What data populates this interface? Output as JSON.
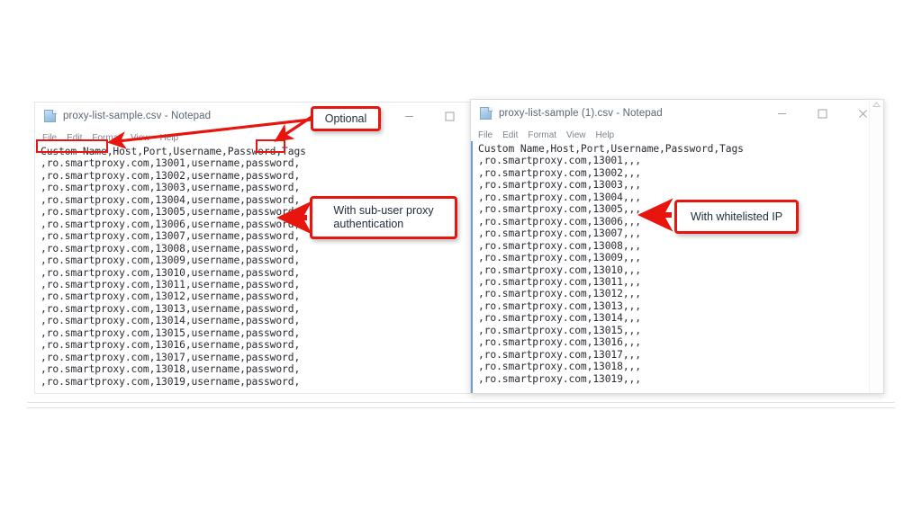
{
  "windows": {
    "left": {
      "title": "proxy-list-sample.csv - Notepad",
      "icon": "notepad-document-icon",
      "menu": [
        "File",
        "Edit",
        "Format",
        "View",
        "Help"
      ],
      "controls": [
        {
          "name": "minimize-button",
          "glyph": "minimize"
        },
        {
          "name": "maximize-button",
          "glyph": "maximize"
        }
      ],
      "text_lines": [
        "Custom Name,Host,Port,Username,Password,Tags",
        ",ro.smartproxy.com,13001,username,password,",
        ",ro.smartproxy.com,13002,username,password,",
        ",ro.smartproxy.com,13003,username,password,",
        ",ro.smartproxy.com,13004,username,password,",
        ",ro.smartproxy.com,13005,username,password,",
        ",ro.smartproxy.com,13006,username,password,",
        ",ro.smartproxy.com,13007,username,password,",
        ",ro.smartproxy.com,13008,username,password,",
        ",ro.smartproxy.com,13009,username,password,",
        ",ro.smartproxy.com,13010,username,password,",
        ",ro.smartproxy.com,13011,username,password,",
        ",ro.smartproxy.com,13012,username,password,",
        ",ro.smartproxy.com,13013,username,password,",
        ",ro.smartproxy.com,13014,username,password,",
        ",ro.smartproxy.com,13015,username,password,",
        ",ro.smartproxy.com,13016,username,password,",
        ",ro.smartproxy.com,13017,username,password,",
        ",ro.smartproxy.com,13018,username,password,",
        ",ro.smartproxy.com,13019,username,password,"
      ]
    },
    "right": {
      "title": "proxy-list-sample (1).csv - Notepad",
      "icon": "notepad-document-icon",
      "menu": [
        "File",
        "Edit",
        "Format",
        "View",
        "Help"
      ],
      "controls": [
        {
          "name": "minimize-button",
          "glyph": "minimize"
        },
        {
          "name": "maximize-button",
          "glyph": "maximize"
        },
        {
          "name": "close-button",
          "glyph": "close"
        }
      ],
      "text_lines": [
        "Custom Name,Host,Port,Username,Password,Tags",
        ",ro.smartproxy.com,13001,,,",
        ",ro.smartproxy.com,13002,,,",
        ",ro.smartproxy.com,13003,,,",
        ",ro.smartproxy.com,13004,,,",
        ",ro.smartproxy.com,13005,,,",
        ",ro.smartproxy.com,13006,,,",
        ",ro.smartproxy.com,13007,,,",
        ",ro.smartproxy.com,13008,,,",
        ",ro.smartproxy.com,13009,,,",
        ",ro.smartproxy.com,13010,,,",
        ",ro.smartproxy.com,13011,,,",
        ",ro.smartproxy.com,13012,,,",
        ",ro.smartproxy.com,13013,,,",
        ",ro.smartproxy.com,13014,,,",
        ",ro.smartproxy.com,13015,,,",
        ",ro.smartproxy.com,13016,,,",
        ",ro.smartproxy.com,13017,,,",
        ",ro.smartproxy.com,13018,,,",
        ",ro.smartproxy.com,13019,,,"
      ]
    }
  },
  "annotations": {
    "optional": "Optional",
    "subuser": "With sub-user proxy\nauthentication",
    "whitelist": "With whitelisted IP",
    "highlighted_fields": [
      "Custom Name",
      "Tags"
    ],
    "accent_color": "#e8150f"
  }
}
